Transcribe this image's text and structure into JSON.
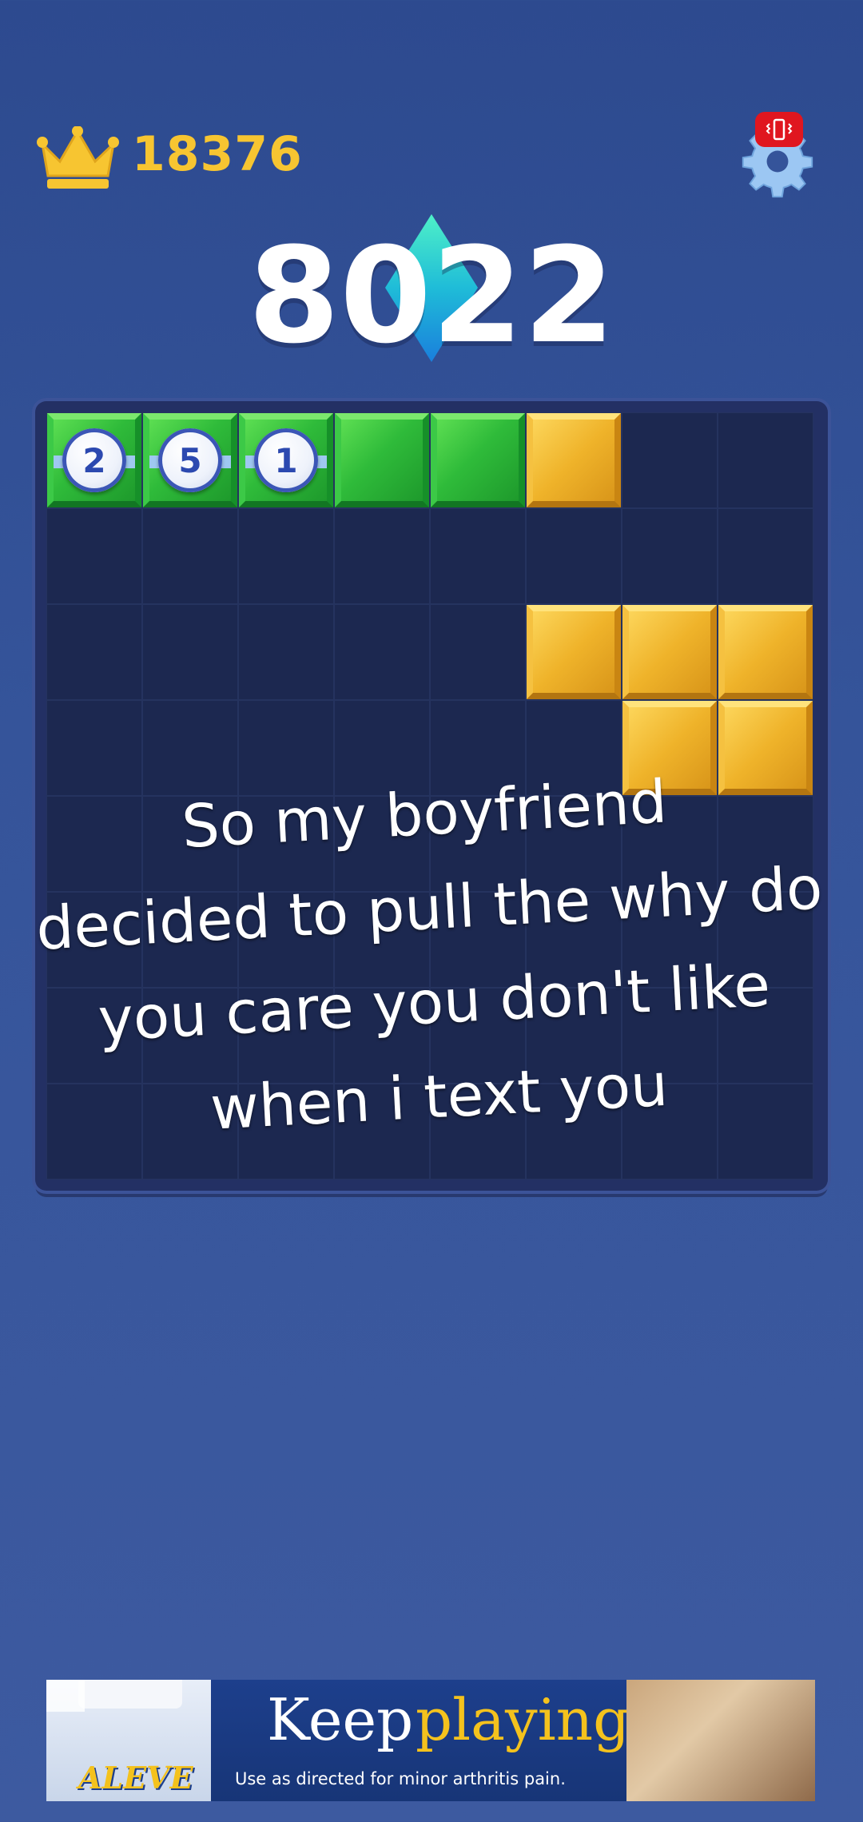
{
  "header": {
    "best_score": "18376",
    "crown_icon": "crown-icon",
    "settings_icon": "gear-icon",
    "vibrate_icon": "vibrate-icon"
  },
  "score": {
    "current": "8022"
  },
  "board": {
    "columns": 8,
    "rows": 8,
    "colors": {
      "green": "#2fbb3a",
      "gold": "#efb32a",
      "empty": "#1c2850"
    },
    "tiles": [
      [
        "green-2",
        "green-5",
        "green-1",
        "green",
        "green",
        "gold",
        "",
        ""
      ],
      [
        "",
        "",
        "",
        "",
        "",
        "",
        "",
        ""
      ],
      [
        "",
        "",
        "",
        "",
        "",
        "gold",
        "gold",
        "gold"
      ],
      [
        "",
        "",
        "",
        "",
        "",
        "",
        "gold",
        "gold"
      ],
      [
        "",
        "",
        "",
        "",
        "",
        "",
        "",
        ""
      ],
      [
        "",
        "",
        "",
        "",
        "",
        "",
        "",
        ""
      ],
      [
        "",
        "",
        "",
        "",
        "",
        "",
        "",
        ""
      ],
      [
        "",
        "",
        "",
        "",
        "",
        "",
        "",
        ""
      ]
    ],
    "ball_numbers": [
      "2",
      "5",
      "1"
    ]
  },
  "caption": {
    "lines": [
      "So my boyfriend",
      "decided to pull the why do",
      "you care you don't like",
      "when i text you"
    ]
  },
  "ad": {
    "headline_1": "Keep",
    "headline_2": "playing",
    "subtext": "Use as directed for minor arthritis pain.",
    "brand": "ALEVE"
  }
}
